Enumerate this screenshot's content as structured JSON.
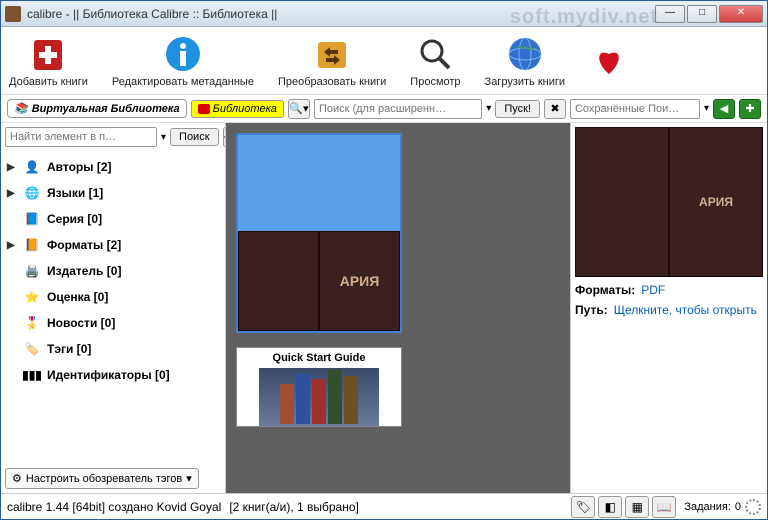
{
  "window": {
    "title": "calibre - || Библиотека Calibre :: Библиотека ||"
  },
  "toolbar": {
    "add": "Добавить книги",
    "edit": "Редактировать метаданные",
    "convert": "Преобразовать книги",
    "view": "Просмотр",
    "fetch": "Загрузить книги"
  },
  "secondary": {
    "virtual_library": "Виртуальная Библиотека",
    "library_label": "Библиотека",
    "search_placeholder": "Поиск (для расширенн…",
    "go": "Пуск!",
    "saved_search_placeholder": "Сохранённые Пои…"
  },
  "sidebar": {
    "find_placeholder": "Найти элемент в п…",
    "search_btn": "Поиск",
    "categories": [
      {
        "label": "Авторы",
        "count": 2
      },
      {
        "label": "Языки",
        "count": 1
      },
      {
        "label": "Серия",
        "count": 0
      },
      {
        "label": "Форматы",
        "count": 2
      },
      {
        "label": "Издатель",
        "count": 0
      },
      {
        "label": "Оценка",
        "count": 0
      },
      {
        "label": "Новости",
        "count": 0
      },
      {
        "label": "Тэги",
        "count": 0
      },
      {
        "label": "Идентификаторы",
        "count": 0
      }
    ],
    "tag_config": "Настроить обозреватель тэгов"
  },
  "books": {
    "selected_cover_text": "АРИЯ",
    "quick_start": "Quick Start Guide"
  },
  "details": {
    "formats_label": "Форматы:",
    "formats_value": "PDF",
    "path_label": "Путь:",
    "path_value": "Щелкните, чтобы открыть"
  },
  "status": {
    "version": "calibre 1.44 [64bit] создано Kovid Goyal",
    "count": "[2 книг(а/и), 1 выбрано]",
    "jobs_label": "Задания:",
    "jobs_count": "0"
  },
  "watermark": "soft.mydiv.net"
}
